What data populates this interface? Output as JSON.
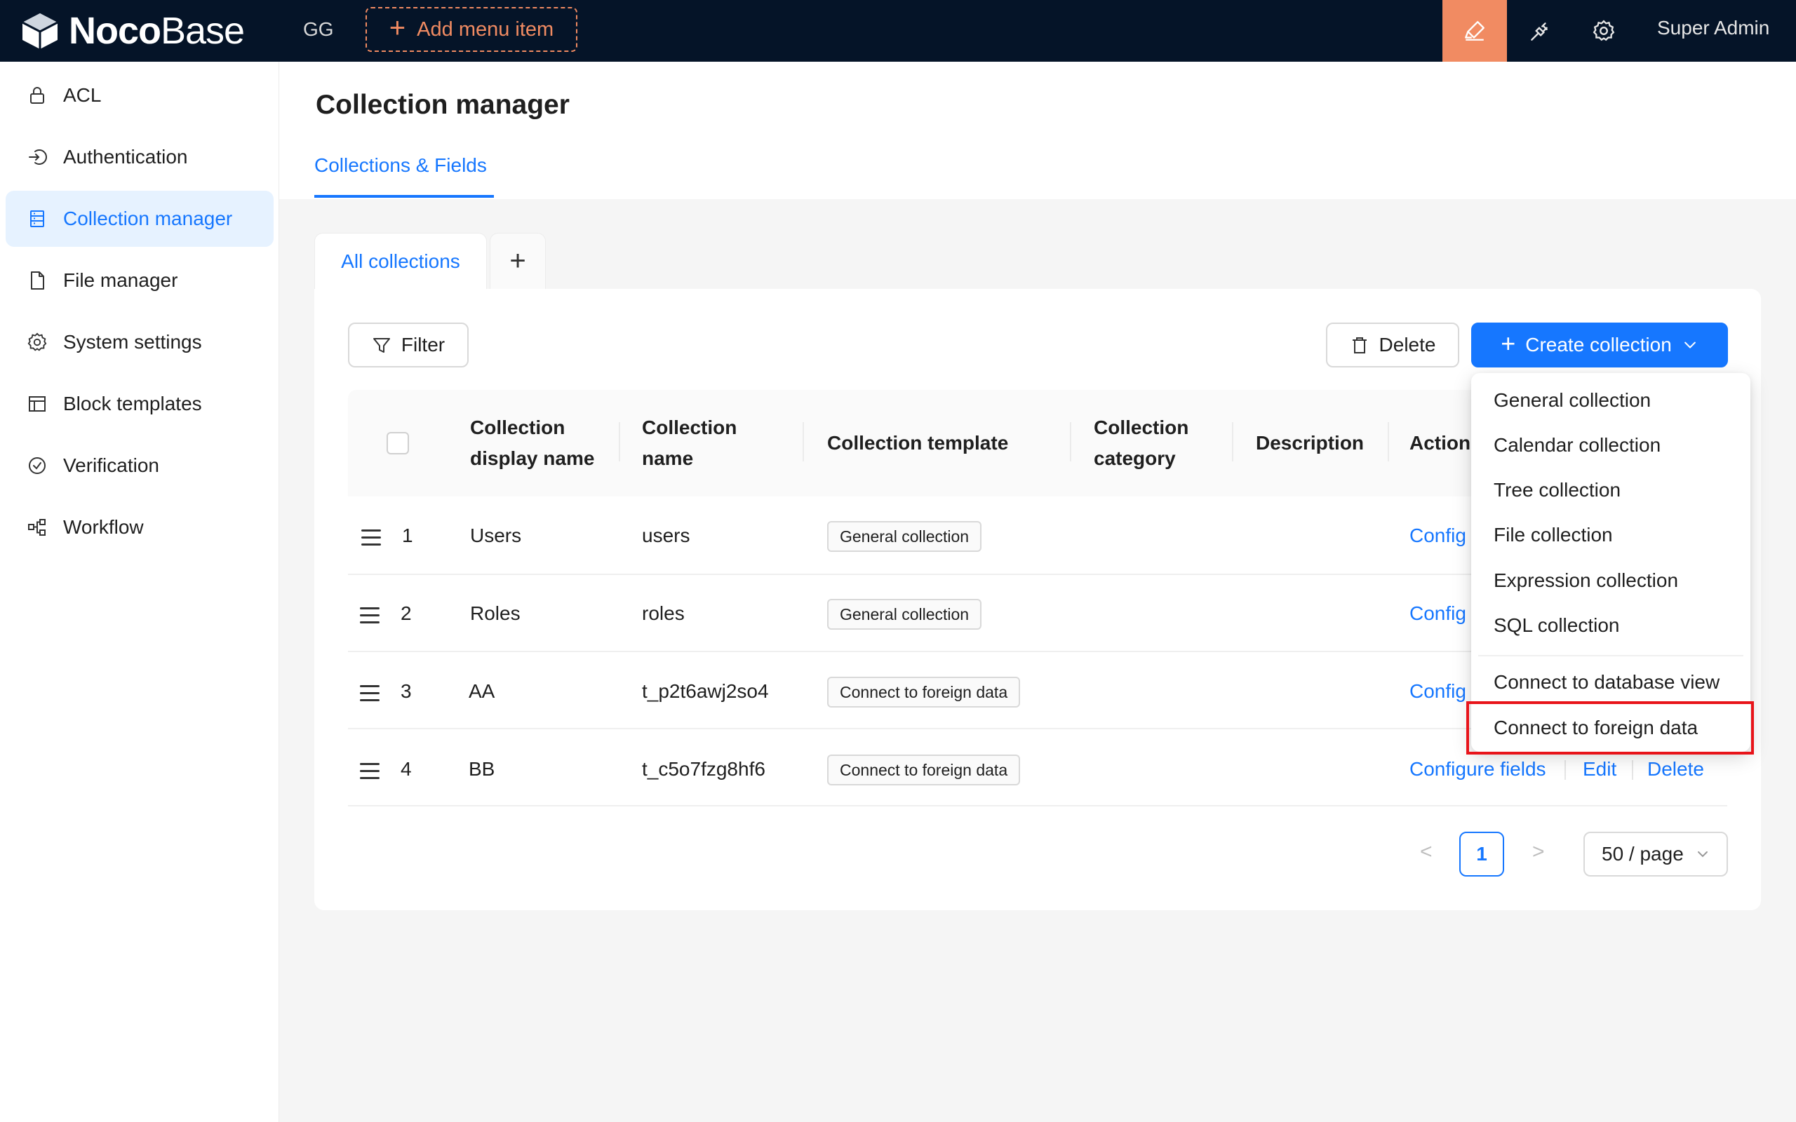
{
  "header": {
    "logo_bold": "Noco",
    "logo_light": "Base",
    "workspace": "GG",
    "add_menu_label": "Add menu item",
    "user_name": "Super Admin",
    "icons": [
      "highlighter-icon",
      "plugin-icon",
      "gear-icon"
    ],
    "accent_color": "#f18b62"
  },
  "sidebar": {
    "items": [
      {
        "label": "ACL",
        "icon": "lock-icon"
      },
      {
        "label": "Authentication",
        "icon": "login-icon"
      },
      {
        "label": "Collection manager",
        "icon": "database-icon",
        "active": true
      },
      {
        "label": "File manager",
        "icon": "file-icon"
      },
      {
        "label": "System settings",
        "icon": "gear-icon"
      },
      {
        "label": "Block templates",
        "icon": "layout-icon"
      },
      {
        "label": "Verification",
        "icon": "check-circle-icon"
      },
      {
        "label": "Workflow",
        "icon": "workflow-icon"
      }
    ]
  },
  "page": {
    "title": "Collection manager",
    "tab": "Collections & Fields"
  },
  "card_tabs": {
    "active_label": "All collections",
    "add_label": "+"
  },
  "toolbar": {
    "filter_label": "Filter",
    "delete_label": "Delete",
    "create_label": "Create collection"
  },
  "table": {
    "columns": {
      "display_name_1": "Collection",
      "display_name_2": "display name",
      "name_1": "Collection",
      "name_2": "name",
      "template": "Collection template",
      "category_1": "Collection",
      "category_2": "category",
      "description": "Description",
      "actions": "Action"
    },
    "rows": [
      {
        "index": "1",
        "display_name": "Users",
        "name": "users",
        "template": "General collection",
        "action_configure": "Config"
      },
      {
        "index": "2",
        "display_name": "Roles",
        "name": "roles",
        "template": "General collection",
        "action_configure": "Config"
      },
      {
        "index": "3",
        "display_name": "AA",
        "name": "t_p2t6awj2so4",
        "template": "Connect to foreign data",
        "action_configure": "Config"
      },
      {
        "index": "4",
        "display_name": "BB",
        "name": "t_c5o7fzg8hf6",
        "template": "Connect to foreign data",
        "action_configure": "Configure fields",
        "action_edit": "Edit",
        "action_delete": "Delete"
      }
    ]
  },
  "pagination": {
    "prev": "<",
    "current": "1",
    "next": ">",
    "page_size": "50 / page"
  },
  "dropdown": {
    "items": [
      "General collection",
      "Calendar collection",
      "Tree collection",
      "File collection",
      "Expression collection",
      "SQL collection",
      "Connect to database view",
      "Connect to foreign data"
    ],
    "highlight_color": "#e8141a"
  }
}
